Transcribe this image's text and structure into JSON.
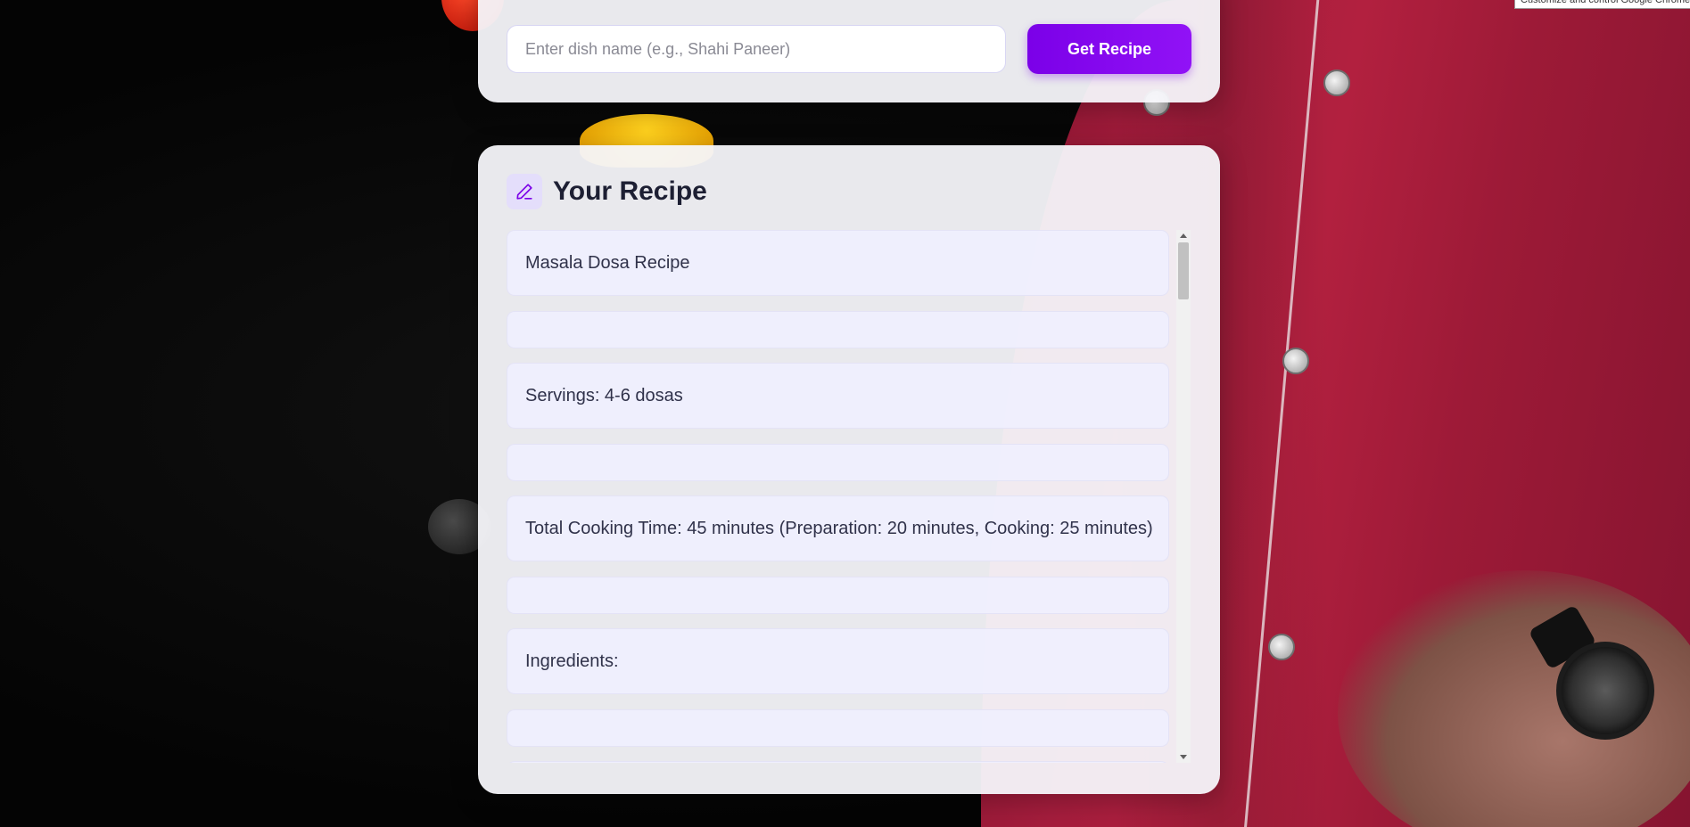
{
  "search": {
    "placeholder": "Enter dish name (e.g., Shahi Paneer)",
    "value": "",
    "button_label": "Get Recipe"
  },
  "recipe": {
    "title": "Your Recipe",
    "icon": "pencil-icon",
    "lines": [
      "Masala Dosa Recipe",
      "",
      "Servings: 4-6 dosas",
      "",
      "Total Cooking Time: 45 minutes (Preparation: 20 minutes, Cooking: 25 minutes)",
      "",
      "Ingredients:",
      "",
      ""
    ]
  },
  "tooltip": {
    "text": "Customize and control Google Chrome"
  },
  "colors": {
    "accent": "#7b00e8",
    "accent_light": "#e4defb",
    "shirt": "#a51d3d"
  }
}
